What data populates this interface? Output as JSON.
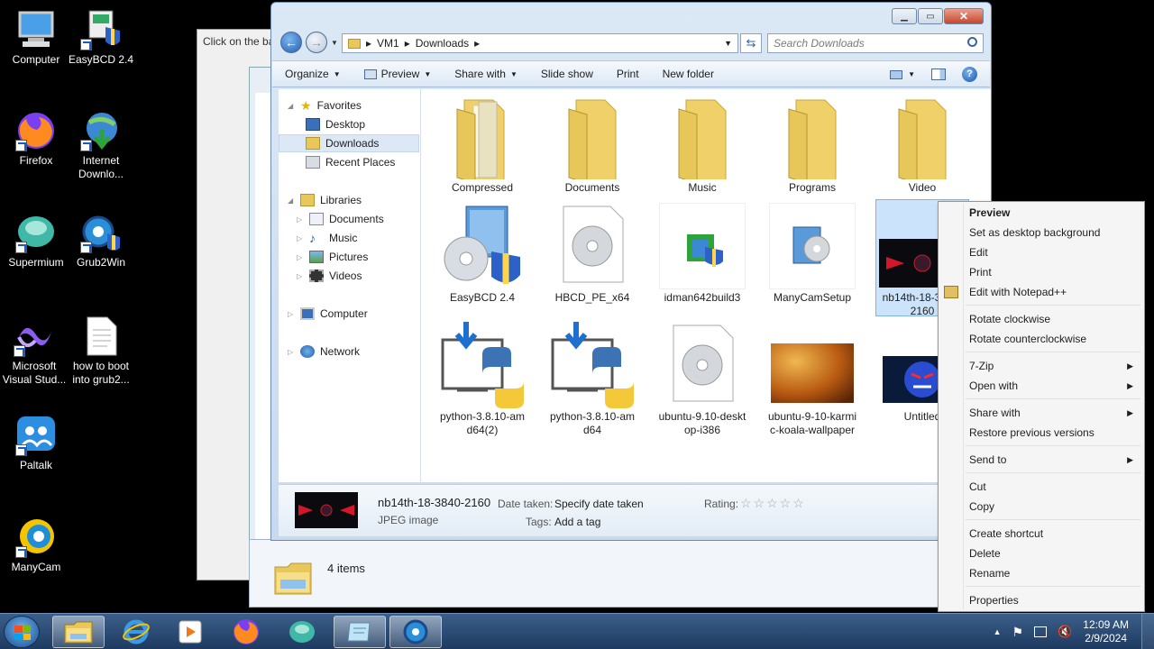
{
  "desktop": {
    "icons": [
      {
        "label": "Computer",
        "icon": "computer-icon"
      },
      {
        "label": "EasyBCD 2.4",
        "icon": "easybcd-icon"
      },
      {
        "label": "Firefox",
        "icon": "firefox-icon"
      },
      {
        "label": "Internet Downlo...",
        "icon": "idm-icon"
      },
      {
        "label": "Supermium",
        "icon": "supermium-icon"
      },
      {
        "label": "Grub2Win",
        "icon": "grub2win-icon"
      },
      {
        "label": "Microsoft Visual Stud...",
        "icon": "visual-studio-icon"
      },
      {
        "label": "how to boot into grub2...",
        "icon": "text-file-icon"
      },
      {
        "label": "Paltalk",
        "icon": "paltalk-icon"
      },
      {
        "label": "ManyCam",
        "icon": "manycam-icon"
      }
    ]
  },
  "bg_window": {
    "text": "Click on the ba",
    "status_count": "4 items"
  },
  "explorer": {
    "breadcrumb": [
      "VM1",
      "Downloads"
    ],
    "search_placeholder": "Search Downloads",
    "toolbar": {
      "organize": "Organize",
      "preview": "Preview",
      "share_with": "Share with",
      "slide_show": "Slide show",
      "print": "Print",
      "new_folder": "New folder"
    },
    "nav": {
      "favorites": "Favorites",
      "desktop": "Desktop",
      "downloads": "Downloads",
      "recent_places": "Recent Places",
      "libraries": "Libraries",
      "documents": "Documents",
      "music": "Music",
      "pictures": "Pictures",
      "videos": "Videos",
      "computer": "Computer",
      "network": "Network"
    },
    "files": [
      {
        "label": "Compressed",
        "type": "folder"
      },
      {
        "label": "Documents",
        "type": "folder"
      },
      {
        "label": "Music",
        "type": "folder"
      },
      {
        "label": "Programs",
        "type": "folder"
      },
      {
        "label": "Video",
        "type": "folder"
      },
      {
        "label": "EasyBCD 2.4",
        "type": "installer"
      },
      {
        "label": "HBCD_PE_x64",
        "type": "disc-image"
      },
      {
        "label": "idman642build3",
        "type": "installer"
      },
      {
        "label": "ManyCamSetup",
        "type": "installer"
      },
      {
        "label": "nb14th-18-3840-2160",
        "type": "image"
      },
      {
        "label": "python-3.8.10-amd64(2)",
        "type": "python-installer"
      },
      {
        "label": "python-3.8.10-amd64",
        "type": "python-installer"
      },
      {
        "label": "ubuntu-9.10-desktop-i386",
        "type": "disc-image"
      },
      {
        "label": "ubuntu-9-10-karmic-koala-wallpaper",
        "type": "image"
      },
      {
        "label": "Untitled",
        "type": "image"
      }
    ],
    "details": {
      "name": "nb14th-18-3840-2160",
      "type": "JPEG image",
      "date_label": "Date taken:",
      "date_value": "Specify date taken",
      "tags_label": "Tags:",
      "tags_value": "Add a tag",
      "rating_label": "Rating:"
    }
  },
  "context_menu": {
    "items": [
      "Preview",
      "Set as desktop background",
      "Edit",
      "Print",
      "Edit with Notepad++",
      "Rotate clockwise",
      "Rotate counterclockwise",
      "7-Zip",
      "Open with",
      "Share with",
      "Restore previous versions",
      "Send to",
      "Cut",
      "Copy",
      "Create shortcut",
      "Delete",
      "Rename",
      "Properties"
    ]
  },
  "taskbar": {
    "time": "12:09 AM",
    "date": "2/9/2024"
  },
  "colors": {
    "selection": "#cce4fb",
    "folder": "#f0d068",
    "taskbar": "#2a4a75"
  }
}
